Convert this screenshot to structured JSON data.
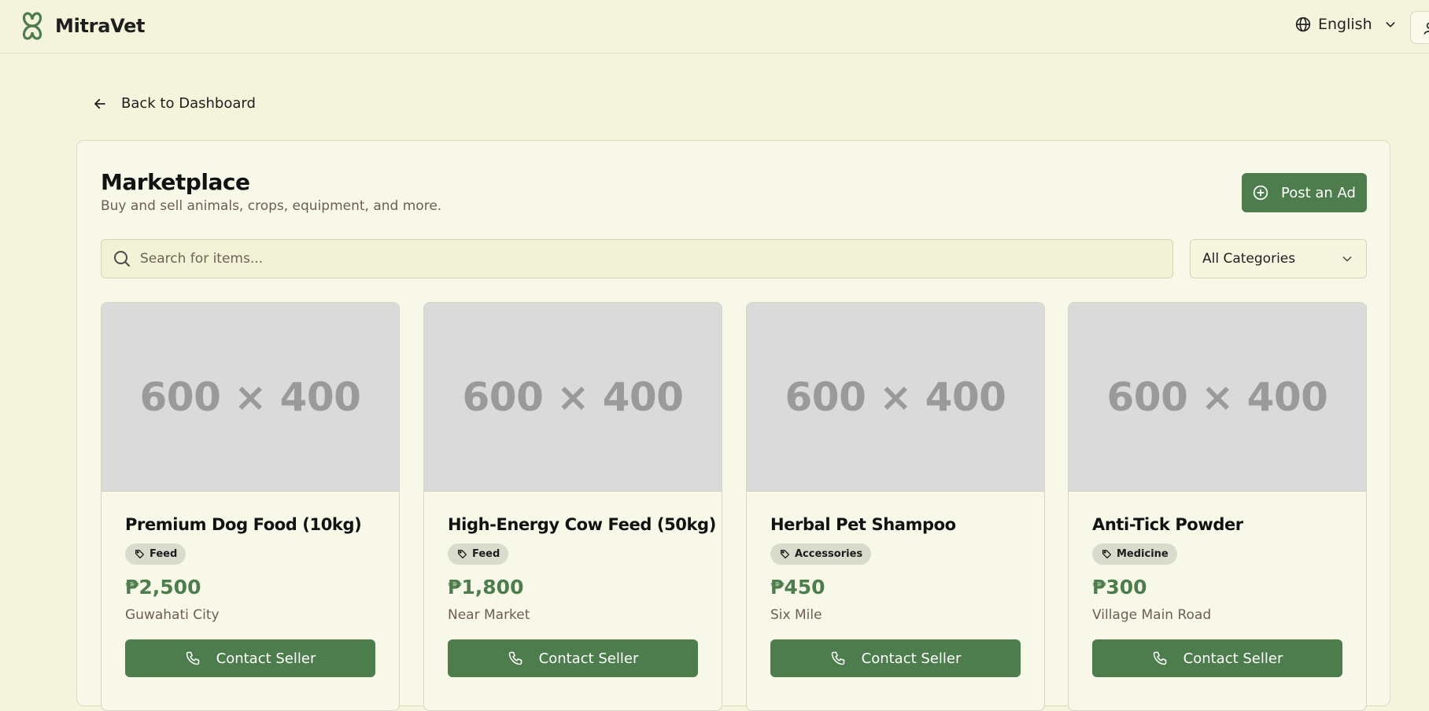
{
  "header": {
    "brand_name": "MitraVet",
    "language": "English"
  },
  "nav": {
    "back_label": "Back to Dashboard"
  },
  "marketplace": {
    "title": "Marketplace",
    "subtitle": "Buy and sell animals, crops, equipment, and more.",
    "post_ad_label": "Post an Ad",
    "search_placeholder": "Search for items...",
    "category_selected": "All Categories"
  },
  "products": [
    {
      "image_text": "600 × 400",
      "name": "Premium Dog Food (10kg)",
      "category": "Feed",
      "price": "₱2,500",
      "location": "Guwahati City",
      "button": "Contact Seller"
    },
    {
      "image_text": "600 × 400",
      "name": "High-Energy Cow Feed (50kg)",
      "category": "Feed",
      "price": "₱1,800",
      "location": "Near Market",
      "button": "Contact Seller"
    },
    {
      "image_text": "600 × 400",
      "name": "Herbal Pet Shampoo",
      "category": "Accessories",
      "price": "₱450",
      "location": "Six Mile",
      "button": "Contact Seller"
    },
    {
      "image_text": "600 × 400",
      "name": "Anti-Tick Powder",
      "category": "Medicine",
      "price": "₱300",
      "location": "Village Main Road",
      "button": "Contact Seller"
    }
  ],
  "colors": {
    "background": "#f4f4dc",
    "primary": "#4e7d4d",
    "muted_text": "#6c5f52",
    "tag_bg": "#d9dccc"
  },
  "icons": [
    "mitravet-logo-icon",
    "globe-icon",
    "chevron-down-icon",
    "user-icon",
    "arrow-left-icon",
    "plus-circle-icon",
    "search-icon",
    "tag-icon",
    "phone-icon"
  ]
}
